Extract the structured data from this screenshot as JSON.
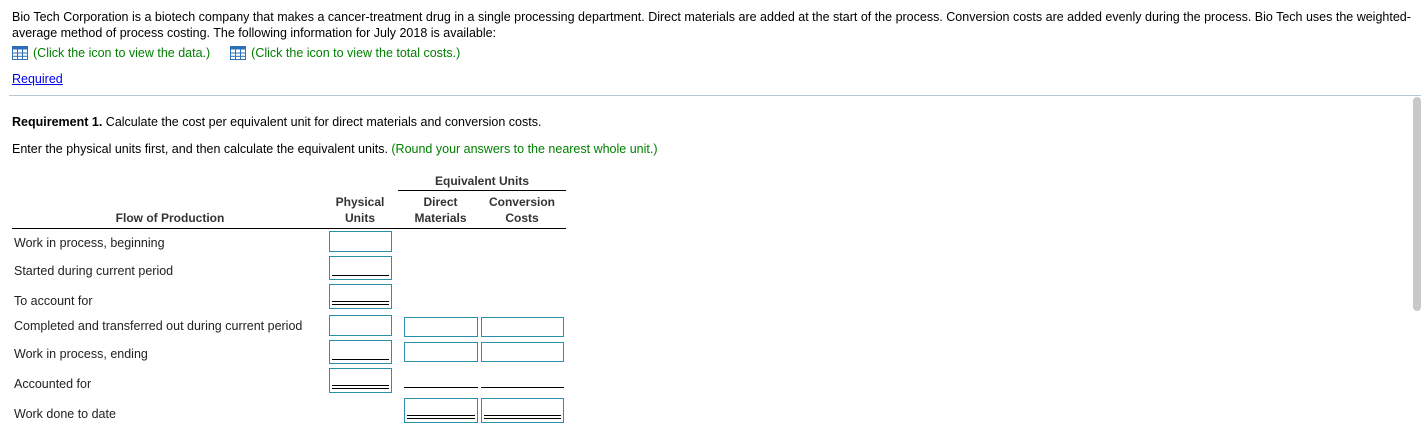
{
  "intro": "Bio Tech Corporation is a biotech company that makes a cancer-treatment drug in a single processing department. Direct materials are added at the start of the process. Conversion costs are added evenly during the process. Bio Tech uses the weighted-average method of process costing. The following information for July 2018 is available:",
  "links": {
    "data_label": "(Click the icon to view the data.)",
    "costs_label": "(Click the icon to view the total costs.)"
  },
  "required_link": "Required",
  "requirement": {
    "bold": "Requirement 1.",
    "text": " Calculate the cost per equivalent unit for direct materials and conversion costs."
  },
  "instruction": {
    "text": "Enter the physical units first, and then calculate the equivalent units. ",
    "note": "(Round your answers to the nearest whole unit.)"
  },
  "table": {
    "equiv_header": "Equivalent Units",
    "col_flow": "Flow of Production",
    "col_physical_1": "Physical",
    "col_physical_2": "Units",
    "col_dm_1": "Direct",
    "col_dm_2": "Materials",
    "col_cc_1": "Conversion",
    "col_cc_2": "Costs",
    "rows": [
      "Work in process, beginning",
      "Started during current period",
      "To account for",
      "Completed and transferred out during current period",
      "Work in process, ending",
      "Accounted for",
      "Work done to date"
    ]
  },
  "colors": {
    "link_green": "#008000",
    "input_border": "#2a8fa8",
    "link_blue": "#0000ee"
  }
}
